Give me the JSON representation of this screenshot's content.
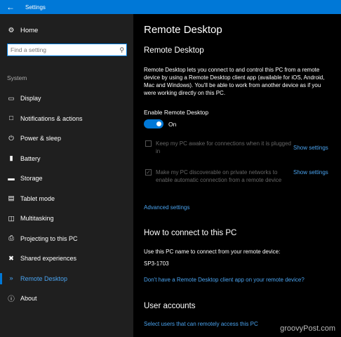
{
  "window": {
    "title": "Settings",
    "back_icon": "arrow-left-icon"
  },
  "sidebar": {
    "home": "Home",
    "search_placeholder": "Find a setting",
    "section": "System",
    "items": [
      {
        "label": "Display",
        "icon": "monitor-icon"
      },
      {
        "label": "Notifications & actions",
        "icon": "notifications-icon"
      },
      {
        "label": "Power & sleep",
        "icon": "power-icon"
      },
      {
        "label": "Battery",
        "icon": "battery-icon"
      },
      {
        "label": "Storage",
        "icon": "storage-icon"
      },
      {
        "label": "Tablet mode",
        "icon": "tablet-icon"
      },
      {
        "label": "Multitasking",
        "icon": "multitasking-icon"
      },
      {
        "label": "Projecting to this PC",
        "icon": "projecting-icon"
      },
      {
        "label": "Shared experiences",
        "icon": "shared-icon"
      },
      {
        "label": "Remote Desktop",
        "icon": "remote-desktop-icon",
        "active": true
      },
      {
        "label": "About",
        "icon": "info-icon"
      }
    ]
  },
  "main": {
    "title": "Remote Desktop",
    "subtitle": "Remote Desktop",
    "description": "Remote Desktop lets you connect to and control this PC from a remote device by using a Remote Desktop client app (available for iOS, Android, Mac and Windows). You'll be able to work from another device as if you were working directly on this PC.",
    "enable_label": "Enable Remote Desktop",
    "toggle_state": "On",
    "checkbox1": {
      "label": "Keep my PC awake for connections when it is plugged in",
      "checked": false,
      "link": "Show settings"
    },
    "checkbox2": {
      "label": "Make my PC discoverable on private networks to enable automatic connection from a remote device",
      "checked": true,
      "link": "Show settings"
    },
    "advanced_link": "Advanced settings",
    "connect_heading": "How to connect to this PC",
    "connect_text": "Use this PC name to connect from your remote device:",
    "pc_name": "SP3-1703",
    "client_link": "Don't have a Remote Desktop client app on your remote device?",
    "accounts_heading": "User accounts",
    "accounts_link": "Select users that can remotely access this PC"
  },
  "watermark": "groovyPost.com",
  "colors": {
    "accent": "#0078d7",
    "link": "#4aa3ef",
    "sidebar_bg": "#1f1f1f",
    "main_bg": "#000000"
  }
}
